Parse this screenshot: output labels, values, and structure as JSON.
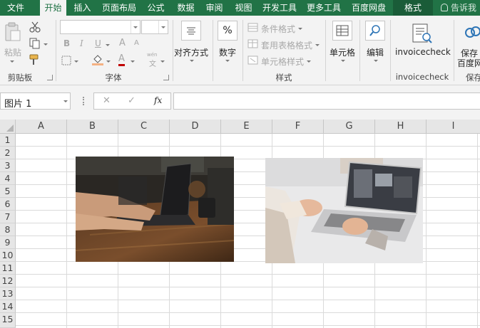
{
  "menu": {
    "tabs": [
      "文件",
      "开始",
      "插入",
      "页面布局",
      "公式",
      "数据",
      "审阅",
      "视图",
      "开发工具",
      "更多工具",
      "百度网盘",
      "格式"
    ],
    "tell_me": "告诉我"
  },
  "ribbon": {
    "clipboard": {
      "paste": "粘贴",
      "group": "剪贴板"
    },
    "font": {
      "bold": "B",
      "italic": "I",
      "underline": "U",
      "grow": "A",
      "shrink": "A",
      "font_color_glyph": "A",
      "phonetic_top": "wén",
      "phonetic_bottom": "文",
      "group": "字体"
    },
    "alignment": {
      "label": "对齐方式"
    },
    "number": {
      "label": "数字",
      "symbol": "%"
    },
    "styles": {
      "conditional": "条件格式",
      "table": "套用表格格式",
      "cell": "单元格样式",
      "group": "样式"
    },
    "cells": {
      "label": "单元格"
    },
    "editing": {
      "label": "编辑"
    },
    "invoicecheck": {
      "label": "invoicecheck",
      "group": "invoicecheck"
    },
    "baidu": {
      "save_line1": "保存",
      "save_line2": "百度网",
      "group": "保存"
    }
  },
  "formula_bar": {
    "name_box": "图片 1",
    "cancel": "✕",
    "enter": "✓",
    "fx": "fx",
    "value": ""
  },
  "grid": {
    "columns": [
      "A",
      "B",
      "C",
      "D",
      "E",
      "F",
      "G",
      "H",
      "I"
    ],
    "rows": [
      "1",
      "2",
      "3",
      "4",
      "5",
      "6",
      "7",
      "8",
      "9",
      "10",
      "11",
      "12",
      "13",
      "14",
      "15"
    ]
  },
  "colors": {
    "accent": "#217346",
    "ribbon": "#f3f3f3",
    "header": "#e6e6e6",
    "gridline": "#dadada"
  }
}
